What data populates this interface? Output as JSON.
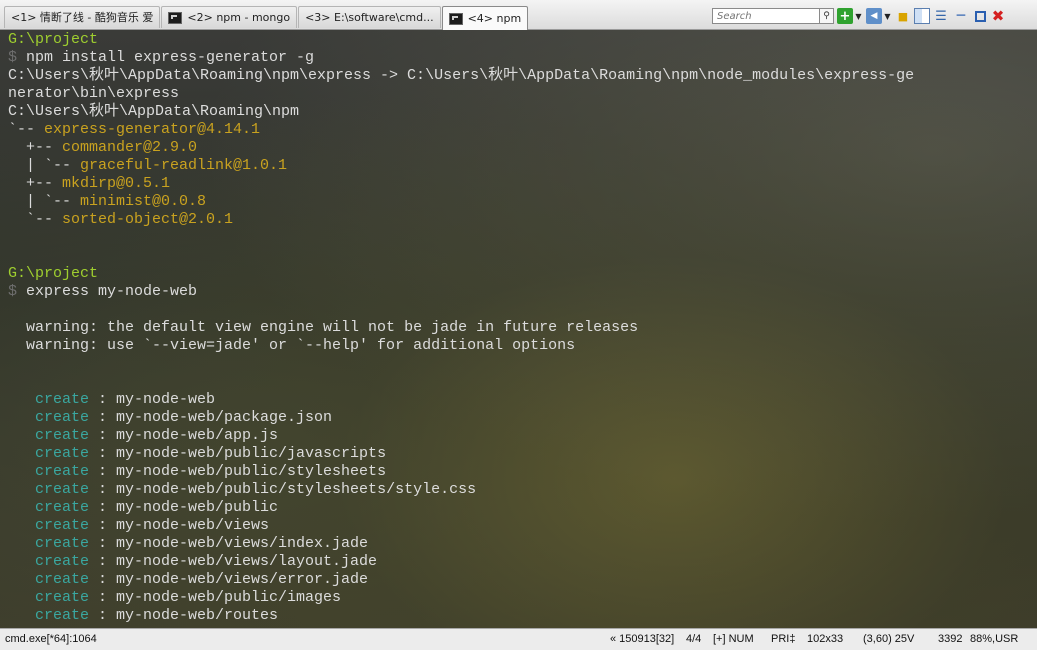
{
  "tabs": [
    {
      "label": "<1> 情断了线 - 酷狗音乐 爱",
      "icon": "",
      "active": false
    },
    {
      "label": "<2> npm - mongo",
      "icon": "console-icon",
      "active": false
    },
    {
      "label": "<3> E:\\software\\cmd...",
      "icon": "",
      "active": false
    },
    {
      "label": "<4> npm",
      "icon": "console-icon",
      "active": true
    }
  ],
  "toolbar": {
    "search_placeholder": "Search",
    "icons": [
      "search-icon",
      "new-console-icon",
      "view-icon",
      "lock-icon",
      "panel-icon",
      "list-icon",
      "minimize-icon",
      "maximize-icon",
      "close-icon"
    ]
  },
  "console": {
    "lines": [
      {
        "segments": [
          {
            "text": "G:\\project",
            "cls": "c-path"
          }
        ]
      },
      {
        "segments": [
          {
            "text": "$ ",
            "cls": "c-dollar"
          },
          {
            "text": "npm install express-generator -g",
            "cls": "c-text"
          }
        ]
      },
      {
        "segments": [
          {
            "text": "C:\\Users\\秋叶\\AppData\\Roaming\\npm\\express -> C:\\Users\\秋叶\\AppData\\Roaming\\npm\\node_modules\\express-ge",
            "cls": "c-text"
          }
        ]
      },
      {
        "segments": [
          {
            "text": "nerator\\bin\\express",
            "cls": "c-text"
          }
        ]
      },
      {
        "segments": [
          {
            "text": "C:\\Users\\秋叶\\AppData\\Roaming\\npm",
            "cls": "c-text"
          }
        ]
      },
      {
        "segments": [
          {
            "text": "`-- ",
            "cls": "c-text"
          },
          {
            "text": "express-generator@4.14.1",
            "cls": "c-pkg"
          }
        ]
      },
      {
        "segments": [
          {
            "text": "  +-- ",
            "cls": "c-text"
          },
          {
            "text": "commander@2.9.0",
            "cls": "c-pkg"
          }
        ]
      },
      {
        "segments": [
          {
            "text": "  | `-- ",
            "cls": "c-text"
          },
          {
            "text": "graceful-readlink@1.0.1",
            "cls": "c-pkg"
          }
        ]
      },
      {
        "segments": [
          {
            "text": "  +-- ",
            "cls": "c-text"
          },
          {
            "text": "mkdirp@0.5.1",
            "cls": "c-pkg"
          }
        ]
      },
      {
        "segments": [
          {
            "text": "  | `-- ",
            "cls": "c-text"
          },
          {
            "text": "minimist@0.0.8",
            "cls": "c-pkg"
          }
        ]
      },
      {
        "segments": [
          {
            "text": "  `-- ",
            "cls": "c-text"
          },
          {
            "text": "sorted-object@2.0.1",
            "cls": "c-pkg"
          }
        ]
      },
      {
        "segments": []
      },
      {
        "segments": []
      },
      {
        "segments": [
          {
            "text": "G:\\project",
            "cls": "c-path"
          }
        ]
      },
      {
        "segments": [
          {
            "text": "$ ",
            "cls": "c-dollar"
          },
          {
            "text": "express my-node-web",
            "cls": "c-text"
          }
        ]
      },
      {
        "segments": []
      },
      {
        "segments": [
          {
            "text": "  warning: the default view engine will not be jade in future releases",
            "cls": "c-text"
          }
        ]
      },
      {
        "segments": [
          {
            "text": "  warning: use `--view=jade' or `--help' for additional options",
            "cls": "c-text"
          }
        ]
      },
      {
        "segments": []
      },
      {
        "segments": []
      },
      {
        "segments": [
          {
            "text": "   create",
            "cls": "c-create"
          },
          {
            "text": " : my-node-web",
            "cls": "c-text"
          }
        ]
      },
      {
        "segments": [
          {
            "text": "   create",
            "cls": "c-create"
          },
          {
            "text": " : my-node-web/package.json",
            "cls": "c-text"
          }
        ]
      },
      {
        "segments": [
          {
            "text": "   create",
            "cls": "c-create"
          },
          {
            "text": " : my-node-web/app.js",
            "cls": "c-text"
          }
        ]
      },
      {
        "segments": [
          {
            "text": "   create",
            "cls": "c-create"
          },
          {
            "text": " : my-node-web/public/javascripts",
            "cls": "c-text"
          }
        ]
      },
      {
        "segments": [
          {
            "text": "   create",
            "cls": "c-create"
          },
          {
            "text": " : my-node-web/public/stylesheets",
            "cls": "c-text"
          }
        ]
      },
      {
        "segments": [
          {
            "text": "   create",
            "cls": "c-create"
          },
          {
            "text": " : my-node-web/public/stylesheets/style.css",
            "cls": "c-text"
          }
        ]
      },
      {
        "segments": [
          {
            "text": "   create",
            "cls": "c-create"
          },
          {
            "text": " : my-node-web/public",
            "cls": "c-text"
          }
        ]
      },
      {
        "segments": [
          {
            "text": "   create",
            "cls": "c-create"
          },
          {
            "text": " : my-node-web/views",
            "cls": "c-text"
          }
        ]
      },
      {
        "segments": [
          {
            "text": "   create",
            "cls": "c-create"
          },
          {
            "text": " : my-node-web/views/index.jade",
            "cls": "c-text"
          }
        ]
      },
      {
        "segments": [
          {
            "text": "   create",
            "cls": "c-create"
          },
          {
            "text": " : my-node-web/views/layout.jade",
            "cls": "c-text"
          }
        ]
      },
      {
        "segments": [
          {
            "text": "   create",
            "cls": "c-create"
          },
          {
            "text": " : my-node-web/views/error.jade",
            "cls": "c-text"
          }
        ]
      },
      {
        "segments": [
          {
            "text": "   create",
            "cls": "c-create"
          },
          {
            "text": " : my-node-web/public/images",
            "cls": "c-text"
          }
        ]
      },
      {
        "segments": [
          {
            "text": "   create",
            "cls": "c-create"
          },
          {
            "text": " : my-node-web/routes",
            "cls": "c-text"
          }
        ]
      }
    ]
  },
  "statusbar": {
    "process": "cmd.exe[*64]:1064",
    "buffer": "« 150913[32]",
    "tab_index": "4/4",
    "keys": "[+] NUM",
    "priority": "PRI‡",
    "size": "102x33",
    "cursor": "(3,60) 25V",
    "pid": "3392",
    "zoom": "88%,USR"
  },
  "colors": {
    "path": "#9fcf2f",
    "package": "#c9a21f",
    "create": "#3aa7a0",
    "text": "#dcdcdc"
  }
}
